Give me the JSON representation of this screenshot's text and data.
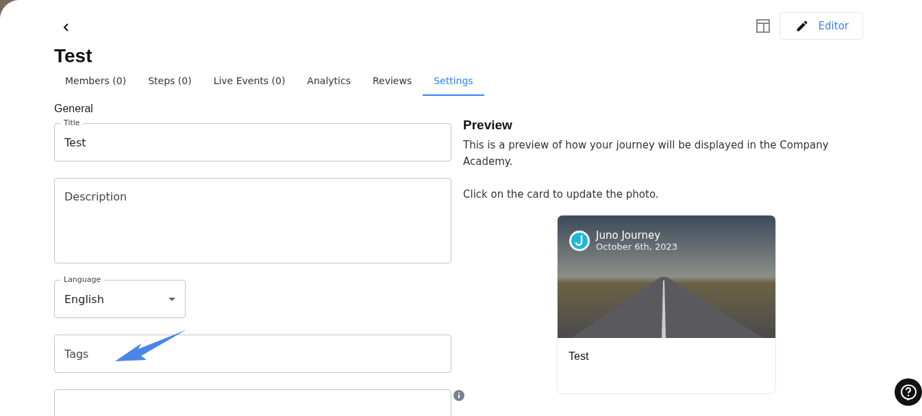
{
  "header": {
    "title": "Test",
    "editor_button": "Editor"
  },
  "tabs": [
    {
      "label": "Members (0)",
      "selected": false
    },
    {
      "label": "Steps (0)",
      "selected": false
    },
    {
      "label": "Live Events (0)",
      "selected": false
    },
    {
      "label": "Analytics",
      "selected": false
    },
    {
      "label": "Reviews",
      "selected": false
    },
    {
      "label": "Settings",
      "selected": true
    }
  ],
  "general": {
    "heading": "General",
    "fields": [
      {
        "kind": "text",
        "label": "Title",
        "value": "Test"
      },
      {
        "kind": "textarea",
        "placeholder": "Description"
      },
      {
        "kind": "select",
        "label": "Language",
        "value": "English"
      },
      {
        "kind": "text",
        "placeholder": "Tags"
      },
      {
        "kind": "info"
      }
    ]
  },
  "preview": {
    "heading": "Preview",
    "description": "This is a preview of how your journey will be displayed in the Company Academy.",
    "hint": "Click on the card to update the photo.",
    "card": {
      "brand": "Juno Journey",
      "date": "October 6th, 2023",
      "title": "Test"
    }
  }
}
